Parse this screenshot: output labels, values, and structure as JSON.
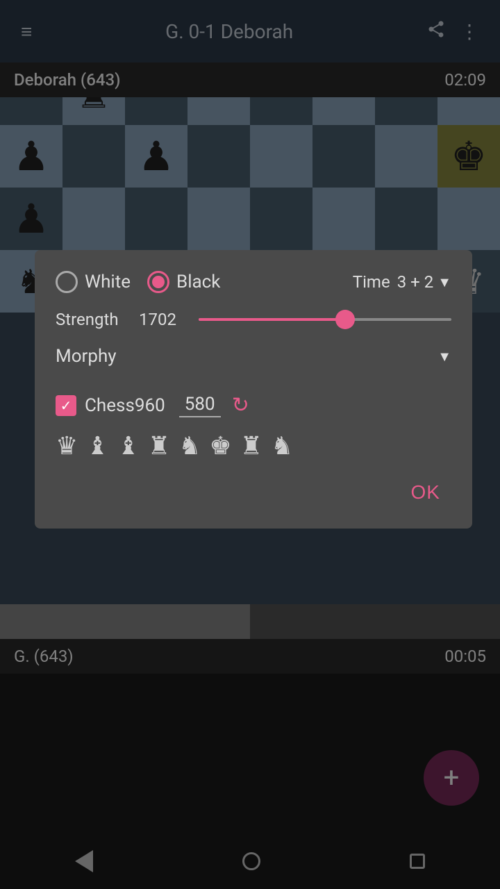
{
  "appBar": {
    "title": "G. 0-1 Deborah",
    "menuIcon": "≡",
    "shareIcon": "share",
    "moreIcon": "⋮"
  },
  "topPlayer": {
    "name": "Deborah (643)",
    "time": "02:09"
  },
  "bottomPlayer": {
    "name": "G. (643)",
    "time": "00:05"
  },
  "dialog": {
    "colorOptions": [
      {
        "id": "white",
        "label": "White",
        "selected": false
      },
      {
        "id": "black",
        "label": "Black",
        "selected": true
      }
    ],
    "timeLabel": "Time",
    "timeValue": "3 + 2",
    "strengthLabel": "Strength",
    "strengthValue": "1702",
    "sliderPercent": 58,
    "opponentName": "Morphy",
    "chess960Label": "Chess960",
    "chess960Number": "580",
    "okLabel": "OK"
  },
  "fab": {
    "icon": "+"
  },
  "navBar": {
    "backLabel": "back",
    "homeLabel": "home",
    "recentLabel": "recent"
  }
}
